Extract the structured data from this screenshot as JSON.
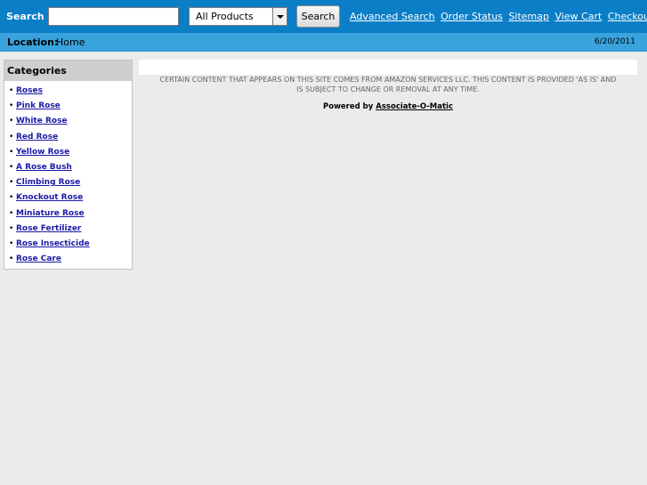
{
  "header": {
    "search_label": "Search",
    "search_value": "",
    "category_selected": "All Products",
    "search_button": "Search",
    "links": [
      "Advanced Search",
      "Order Status",
      "Sitemap",
      "View Cart",
      "Checkout"
    ]
  },
  "location": {
    "label": "Location:",
    "value": "Home",
    "date": "6/20/2011"
  },
  "sidebar": {
    "title": "Categories",
    "items": [
      "Roses",
      "Pink Rose",
      "White Rose",
      "Red Rose",
      "Yellow Rose",
      "A Rose Bush",
      "Climbing Rose",
      "Knockout Rose",
      "Miniature Rose",
      "Rose Fertilizer",
      "Rose Insecticide",
      "Rose Care"
    ]
  },
  "main": {
    "disclaimer_line1": "CERTAIN CONTENT THAT APPEARS ON THIS SITE COMES FROM AMAZON SERVICES LLC. THIS CONTENT IS PROVIDED 'AS IS' AND",
    "disclaimer_line2": "IS SUBJECT TO CHANGE OR REMOVAL AT ANY TIME.",
    "powered_prefix": "Powered by",
    "powered_link": "Associate-O-Matic"
  },
  "colors": {
    "topbar": "#0a7ec6",
    "locbar": "#3aa3dd",
    "link": "#1a1aa6"
  }
}
